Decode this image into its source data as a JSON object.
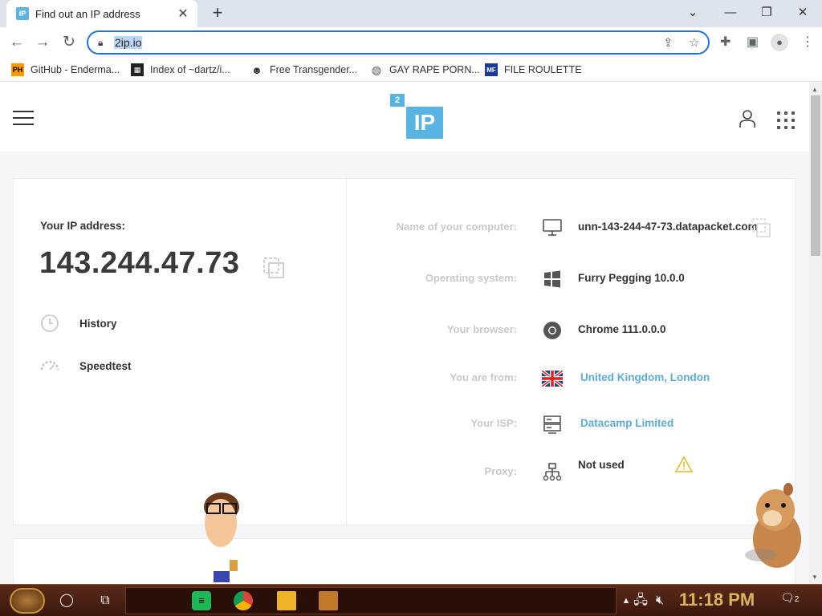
{
  "browser": {
    "tab_title": "Find out an IP address",
    "tab_favicon": "IP",
    "url": "2ip.io"
  },
  "bookmarks": [
    {
      "label": "GitHub - Enderma...",
      "icon": "PH"
    },
    {
      "label": "Index of ~dartz/i...",
      "icon": "folder-icon"
    },
    {
      "label": "Free Transgender...",
      "icon": "mask-icon"
    },
    {
      "label": "GAY RAPE PORN...",
      "icon": "globe-icon"
    },
    {
      "label": "FILE ROULETTE",
      "icon": "flag-icon"
    }
  ],
  "site": {
    "logo_text": "IP",
    "logo_badge": "2"
  },
  "ip_panel": {
    "label": "Your IP address:",
    "value": "143.244.47.73",
    "links": [
      "History",
      "Speedtest"
    ]
  },
  "info": [
    {
      "label": "Name of your computer:",
      "value": "unn-143-244-47-73.datapacket.com",
      "icon": "monitor-icon",
      "is_link": false
    },
    {
      "label": "Operating system:",
      "value": "Furry Pegging 10.0.0",
      "icon": "windows-icon",
      "is_link": false
    },
    {
      "label": "Your browser:",
      "value": "Chrome 111.0.0.0",
      "icon": "chrome-icon",
      "is_link": false
    },
    {
      "label": "You are from:",
      "value": "United Kingdom, London",
      "icon": "uk-flag-icon",
      "is_link": true
    },
    {
      "label": "Your ISP:",
      "value": "Datacamp Limited",
      "icon": "server-icon",
      "is_link": true
    },
    {
      "label": "Proxy:",
      "value": "Not used",
      "icon": "network-icon",
      "is_link": false
    }
  ],
  "taskbar": {
    "clock": "11:18 PM",
    "notifications": "2"
  },
  "colors": {
    "accent": "#57b4e3",
    "link": "#5aaed6",
    "label_gray": "#c9c9c9",
    "warning": "#e8c23a"
  }
}
